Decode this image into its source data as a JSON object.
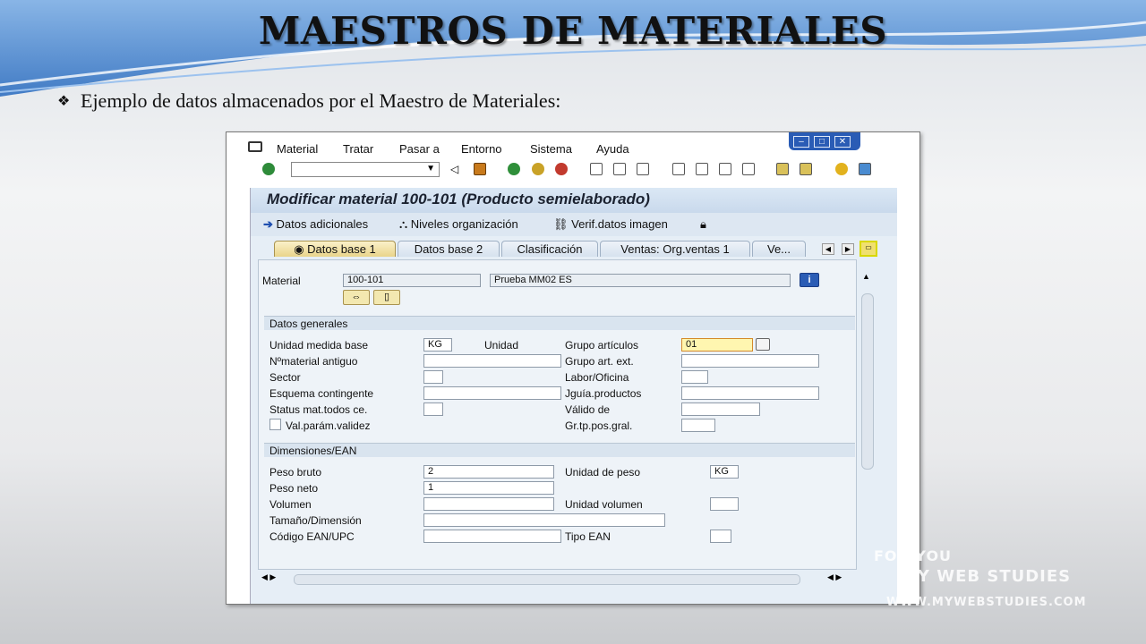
{
  "slide": {
    "title": "MAESTROS DE MATERIALES",
    "bullet": "Ejemplo de datos almacenados por el Maestro de Materiales:"
  },
  "sap": {
    "menu": [
      "Material",
      "Tratar",
      "Pasar a",
      "Entorno",
      "Sistema",
      "Ayuda"
    ],
    "window_controls": [
      "minimize",
      "maximize",
      "close"
    ],
    "command_field": {
      "value": "",
      "placeholder": ""
    },
    "screen_title": "Modificar material 100-101 (Producto semielaborado)",
    "app_toolbar": {
      "datos_adicionales": "Datos adicionales",
      "niveles": "Niveles organización",
      "verif": "Verif.datos imagen"
    },
    "tabs": [
      "Datos base 1",
      "Datos base 2",
      "Clasificación",
      "Ventas: Org.ventas 1",
      "Ve..."
    ],
    "material": {
      "label": "Material",
      "number": "100-101",
      "description": "Prueba MM02 ES"
    },
    "datos_generales": {
      "header": "Datos generales",
      "unidad_medida_base_label": "Unidad medida base",
      "unidad_medida_base_value": "KG",
      "unidad_text": "Unidad",
      "grupo_articulos_label": "Grupo artículos",
      "grupo_articulos_value": "01",
      "nmaterial_antiguo_label": "Nºmaterial antiguo",
      "grupo_art_ext_label": "Grupo art. ext.",
      "sector_label": "Sector",
      "labor_oficina_label": "Labor/Oficina",
      "esquema_label": "Esquema contingente",
      "jguia_label": "Jguía.productos",
      "status_label": "Status mat.todos ce.",
      "valido_de_label": "Válido de",
      "val_param_label": "Val.parám.validez",
      "gr_tp_label": "Gr.tp.pos.gral."
    },
    "dimensiones": {
      "header": "Dimensiones/EAN",
      "peso_bruto_label": "Peso bruto",
      "peso_bruto_value": "2",
      "unidad_peso_label": "Unidad de peso",
      "unidad_peso_value": "KG",
      "peso_neto_label": "Peso neto",
      "peso_neto_value": "1",
      "volumen_label": "Volumen",
      "unidad_volumen_label": "Unidad volumen",
      "tamano_label": "Tamaño/Dimensión",
      "codigo_ean_label": "Código EAN/UPC",
      "tipo_ean_label": "Tipo EAN"
    }
  },
  "watermark": {
    "line1": "FOR YOU",
    "line2": "MY WEB STUDIES",
    "line3": "WWW.MYWEBSTUDIES.COM"
  }
}
